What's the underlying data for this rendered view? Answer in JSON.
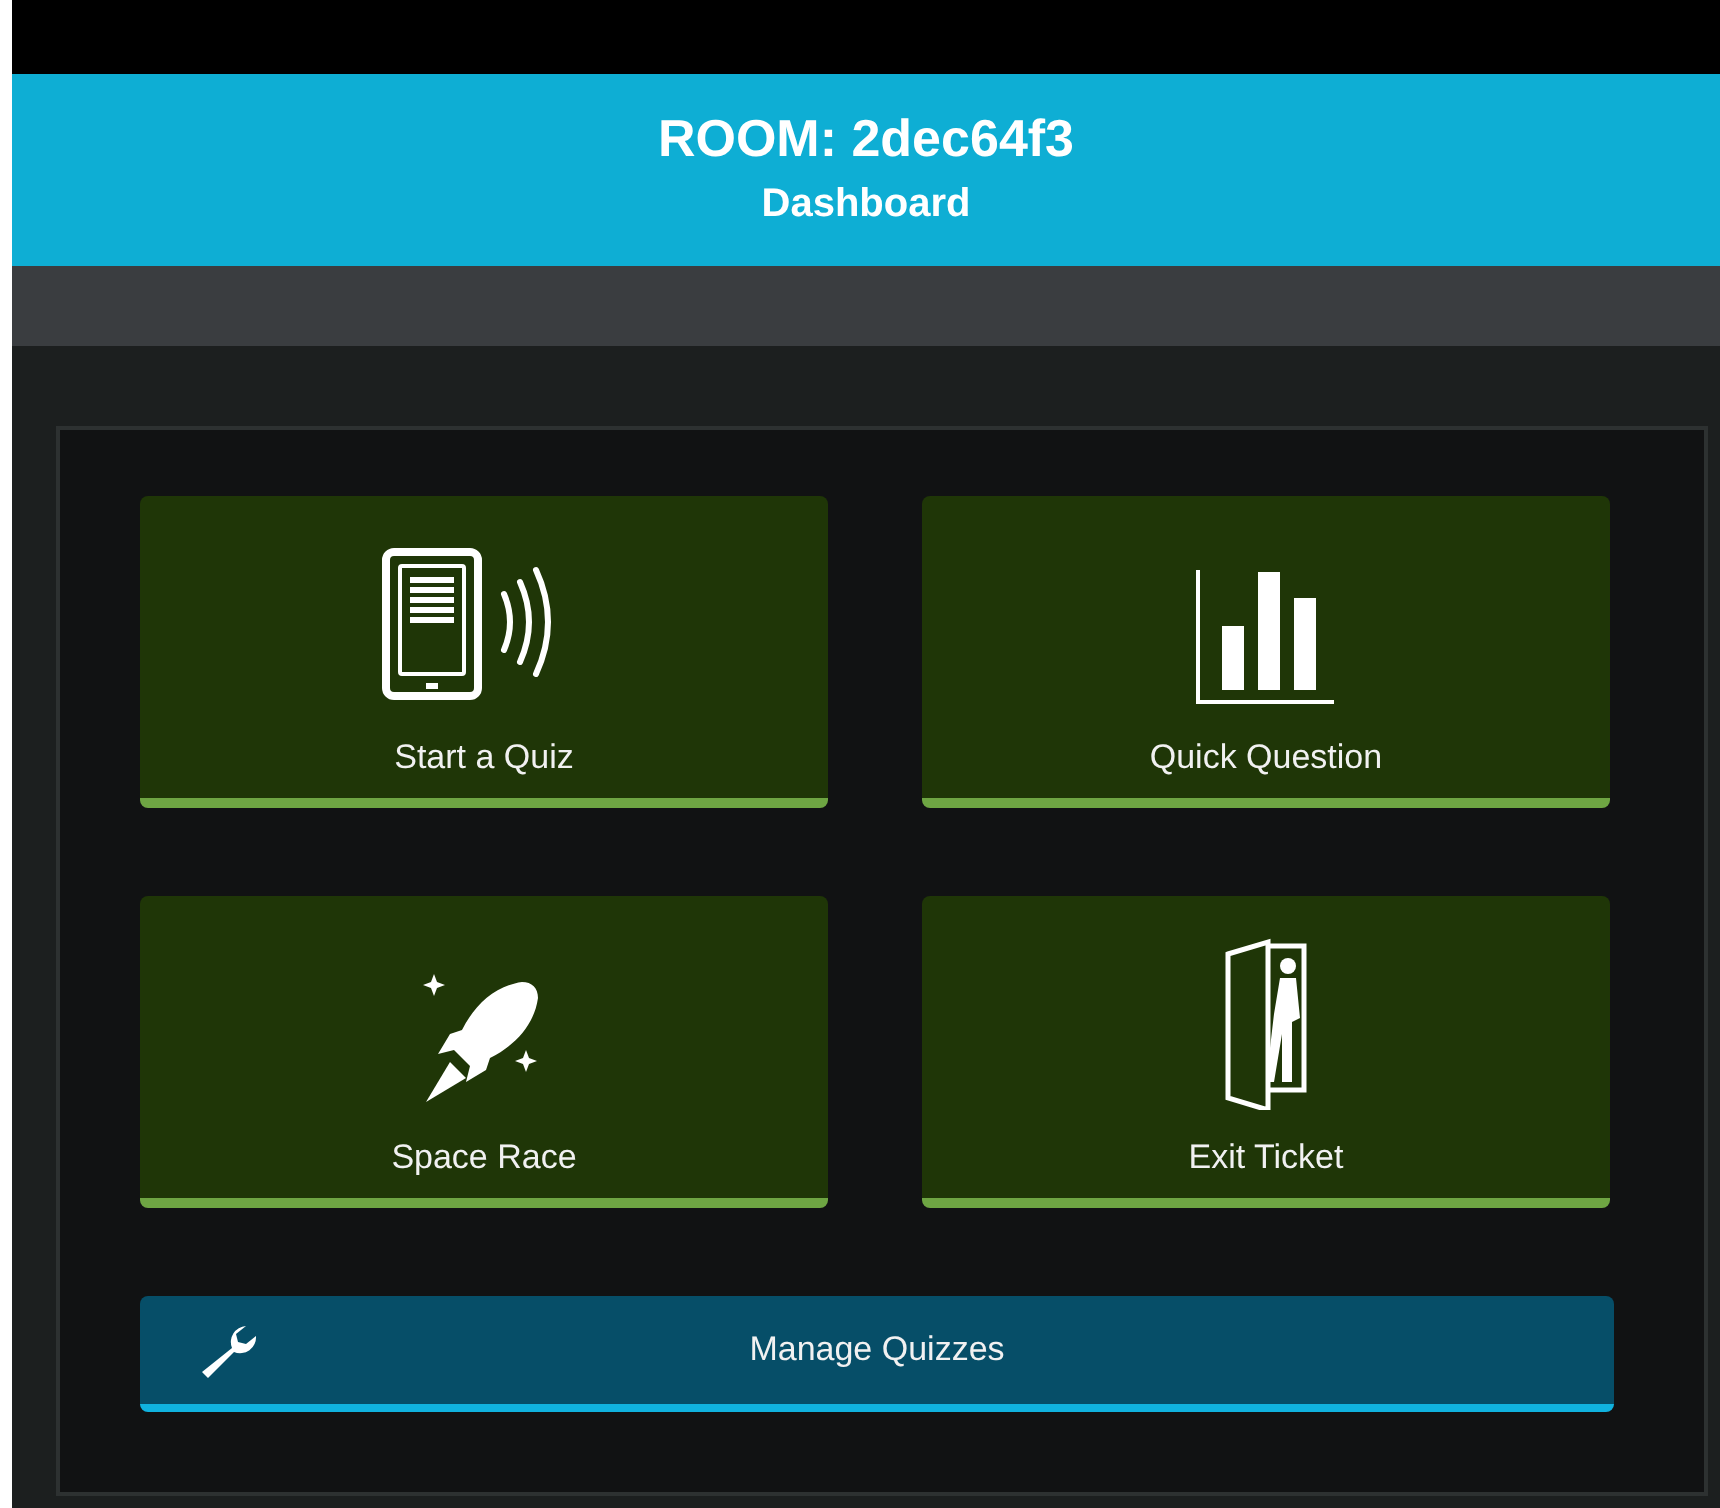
{
  "header": {
    "title": "ROOM: 2dec64f3",
    "subtitle": "Dashboard"
  },
  "tiles": [
    {
      "kind": "tablet",
      "label": "Start a Quiz"
    },
    {
      "kind": "chart",
      "label": "Quick Question"
    },
    {
      "kind": "rocket",
      "label": "Space Race"
    },
    {
      "kind": "exit",
      "label": "Exit Ticket"
    }
  ],
  "manage_button": {
    "label": "Manage Quizzes"
  }
}
